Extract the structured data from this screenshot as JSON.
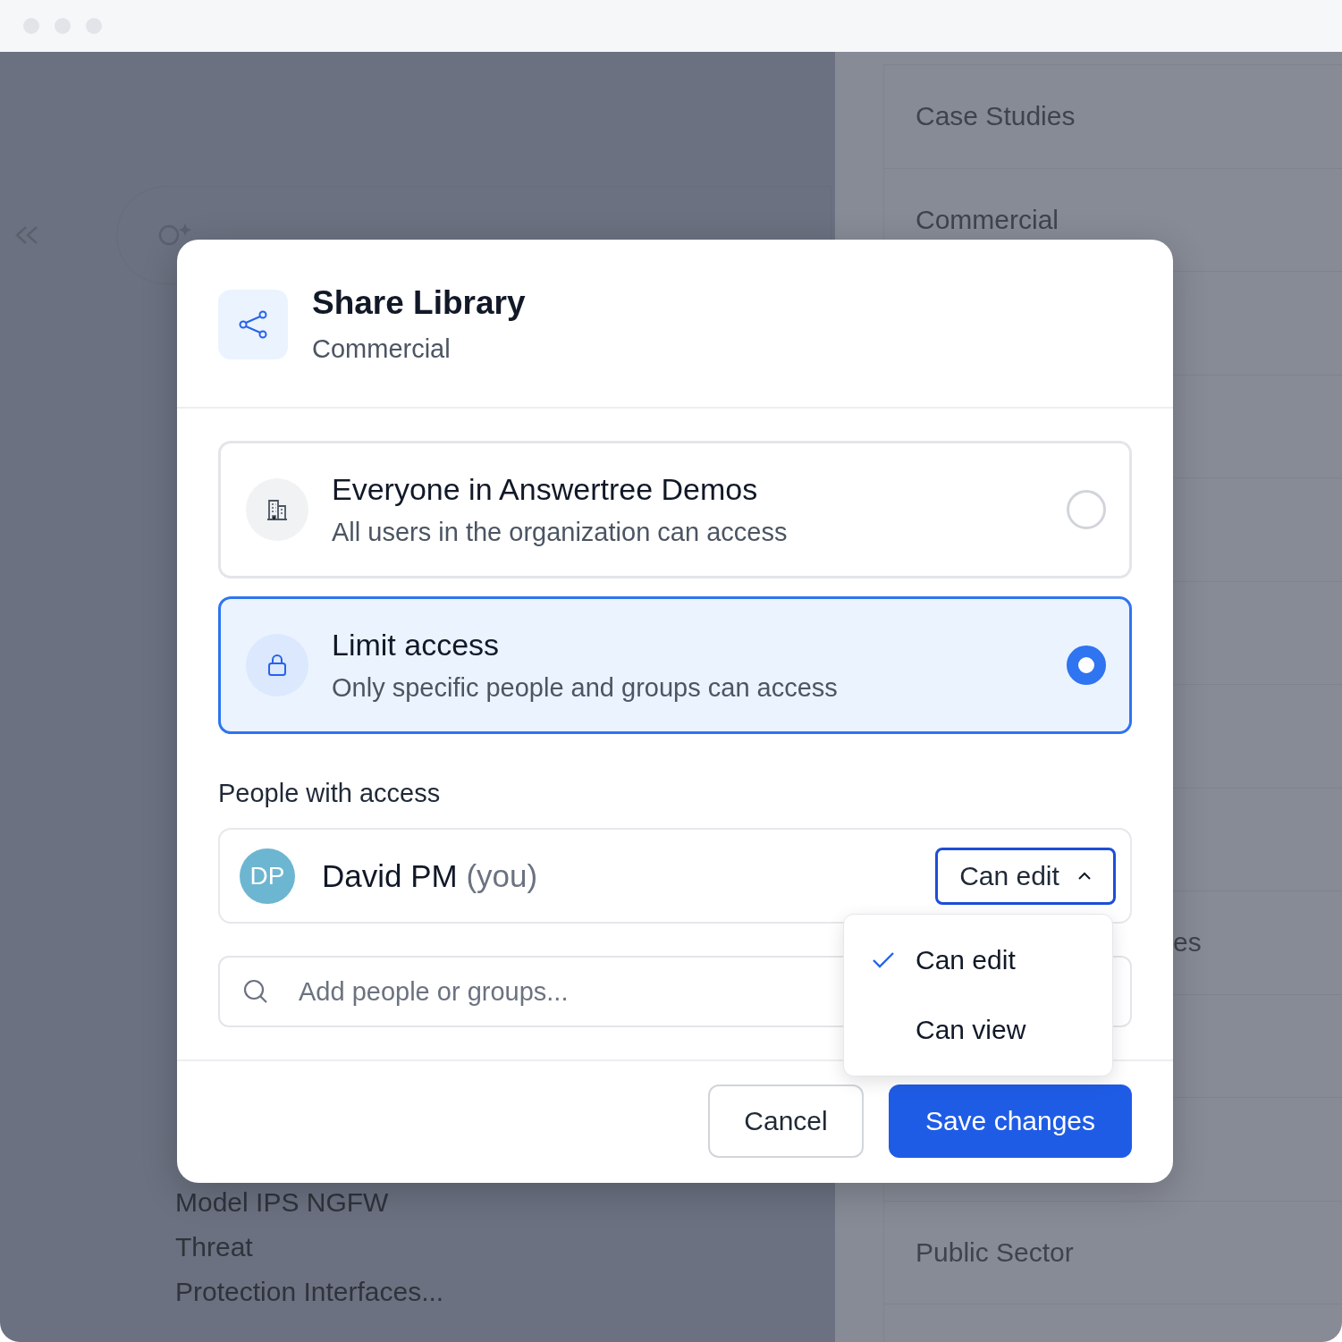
{
  "background": {
    "left_items": [
      "Model IPS NGFW",
      "Threat",
      "Protection Interfaces..."
    ],
    "right_items": [
      {
        "kind": "full",
        "label": "Case Studies"
      },
      {
        "kind": "full",
        "label": "Commercial"
      },
      {
        "kind": "blank"
      },
      {
        "kind": "blank"
      },
      {
        "kind": "blank"
      },
      {
        "kind": "blank"
      },
      {
        "kind": "blank"
      },
      {
        "kind": "blank"
      },
      {
        "kind": "clipped",
        "label": "es"
      },
      {
        "kind": "blank"
      },
      {
        "kind": "blank"
      },
      {
        "kind": "full",
        "label": "Public Sector"
      },
      {
        "kind": "blank"
      }
    ]
  },
  "dialog": {
    "title": "Share Library",
    "subtitle": "Commercial",
    "options": [
      {
        "kind": "organization",
        "title": "Everyone in Answertree Demos",
        "description": "All users in the organization can access",
        "selected": false
      },
      {
        "kind": "restricted",
        "title": "Limit access",
        "description": "Only specific people and groups can access",
        "selected": true
      }
    ],
    "people_heading": "People with access",
    "people": [
      {
        "initials": "DP",
        "name": "David PM",
        "note": "(you)",
        "role": "Can edit",
        "menu_open": true
      }
    ],
    "role_menu": [
      {
        "label": "Can edit",
        "selected": true
      },
      {
        "label": "Can view",
        "selected": false
      }
    ],
    "add_field": {
      "placeholder": "Add people or groups..."
    },
    "buttons": [
      {
        "kind": "secondary",
        "label": "Cancel"
      },
      {
        "kind": "primary",
        "label": "Save changes"
      }
    ]
  }
}
